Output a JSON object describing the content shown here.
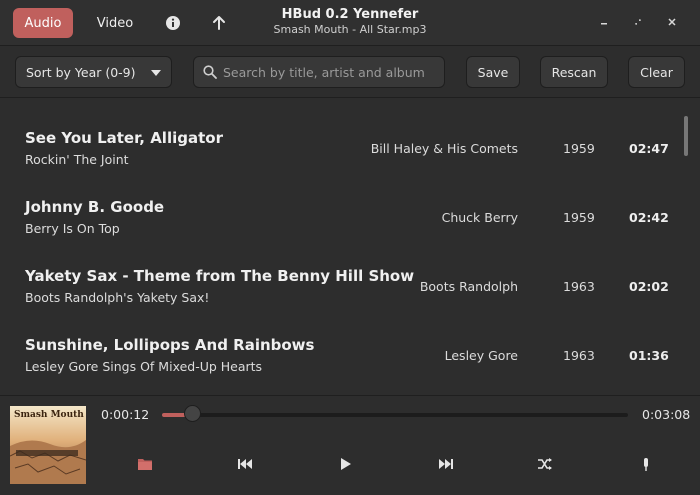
{
  "header": {
    "tabs": [
      {
        "label": "Audio",
        "active": true
      },
      {
        "label": "Video",
        "active": false
      }
    ],
    "title": "HBud 0.2 Yennefer",
    "subtitle": "Smash Mouth - All Star.mp3",
    "accent_color": "#c0605d"
  },
  "toolbar": {
    "sort_label": "Sort by Year (0-9)",
    "search_placeholder": "Search by title, artist and album",
    "search_value": "",
    "save_label": "Save",
    "rescan_label": "Rescan",
    "clear_label": "Clear"
  },
  "tracks": [
    {
      "title": "See You Later, Alligator",
      "album": "Rockin' The Joint",
      "artist": "Bill Haley & His Comets",
      "year": "1959",
      "duration": "02:47"
    },
    {
      "title": "Johnny B. Goode",
      "album": "Berry Is On Top",
      "artist": "Chuck Berry",
      "year": "1959",
      "duration": "02:42"
    },
    {
      "title": "Yakety Sax - Theme from The Benny Hill Show",
      "album": "Boots Randolph's Yakety Sax!",
      "artist": "Boots Randolph",
      "year": "1963",
      "duration": "02:02"
    },
    {
      "title": "Sunshine, Lollipops And Rainbows",
      "album": "Lesley Gore Sings Of Mixed-Up Hearts",
      "artist": "Lesley Gore",
      "year": "1963",
      "duration": "01:36"
    }
  ],
  "player": {
    "current_time": "0:00:12",
    "total_time": "0:03:08",
    "progress_fraction": 0.064,
    "cover_text": "Smash Mouth",
    "icons": [
      "folder-icon",
      "previous-icon",
      "play-icon",
      "next-icon",
      "shuffle-icon",
      "volume-icon"
    ]
  }
}
